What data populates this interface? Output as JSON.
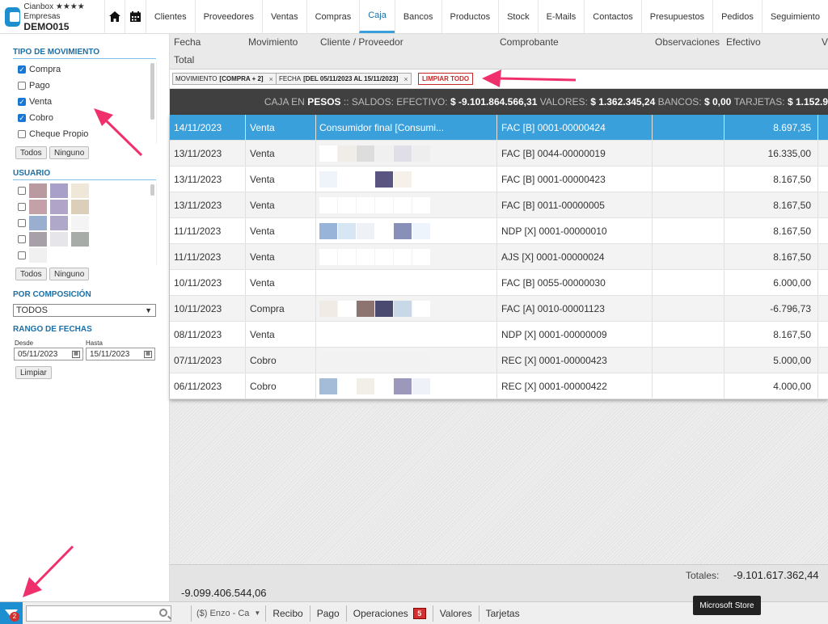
{
  "app": {
    "brand_line1": "Cianbox ★★★★ Empresas",
    "brand_line2": "DEMO015"
  },
  "nav": [
    "Clientes",
    "Proveedores",
    "Ventas",
    "Compras",
    "Caja",
    "Bancos",
    "Productos",
    "Stock",
    "E-Mails",
    "Contactos",
    "Presupuestos",
    "Pedidos",
    "Seguimiento"
  ],
  "nav_active": "Caja",
  "sidebar": {
    "tipo_title": "TIPO DE MOVIMIENTO",
    "tipo_items": [
      {
        "label": "Compra",
        "checked": true
      },
      {
        "label": "Pago",
        "checked": false
      },
      {
        "label": "Venta",
        "checked": true
      },
      {
        "label": "Cobro",
        "checked": true
      },
      {
        "label": "Cheque Propio",
        "checked": false
      }
    ],
    "btn_todos": "Todos",
    "btn_ninguno": "Ninguno",
    "usuario_title": "USUARIO",
    "composicion_title": "POR COMPOSICIÓN",
    "composicion_value": "TODOS",
    "rango_title": "RANGO DE FECHAS",
    "desde_label": "Desde",
    "hasta_label": "Hasta",
    "desde_value": "05/11/2023",
    "hasta_value": "15/11/2023",
    "btn_limpiar": "Limpiar"
  },
  "columns": {
    "fecha": "Fecha",
    "movimiento": "Movimiento",
    "cliente": "Cliente / Proveedor",
    "comprobante": "Comprobante",
    "observaciones": "Observaciones",
    "efectivo": "Efectivo",
    "v": "V",
    "total": "Total"
  },
  "chips": {
    "mov_label": "MOVIMIENTO",
    "mov_value": "[COMPRA + 2]",
    "fecha_label": "FECHA",
    "fecha_value": "[DEL 05/11/2023 AL 15/11/2023]",
    "clear": "LIMPIAR TODO",
    "x": "×"
  },
  "saldos": {
    "prefix": "CAJA EN",
    "moneda": "PESOS",
    "label_efectivo": ":: SALDOS: EFECTIVO:",
    "efectivo": "$ -9.101.864.566,31",
    "label_valores": "VALORES:",
    "valores": "$ 1.362.345,24",
    "label_bancos": "BANCOS:",
    "bancos": "$ 0,00",
    "label_tarjetas": "TARJETAS:",
    "tarjetas": "$ 1.152.9"
  },
  "rows": [
    {
      "fecha": "14/11/2023",
      "mov": "Venta",
      "cliente": "Consumidor final [Consumi...",
      "comp": "FAC [B] 0001-00000424",
      "efectivo": "8.697,35"
    },
    {
      "fecha": "13/11/2023",
      "mov": "Venta",
      "cliente": "",
      "comp": "FAC [B] 0044-00000019",
      "efectivo": "16.335,00"
    },
    {
      "fecha": "13/11/2023",
      "mov": "Venta",
      "cliente": "",
      "comp": "FAC [B] 0001-00000423",
      "efectivo": "8.167,50"
    },
    {
      "fecha": "13/11/2023",
      "mov": "Venta",
      "cliente": "",
      "comp": "FAC [B] 0011-00000005",
      "efectivo": "8.167,50"
    },
    {
      "fecha": "11/11/2023",
      "mov": "Venta",
      "cliente": "",
      "comp": "NDP [X] 0001-00000010",
      "efectivo": "8.167,50"
    },
    {
      "fecha": "11/11/2023",
      "mov": "Venta",
      "cliente": "",
      "comp": "AJS [X] 0001-00000024",
      "efectivo": "8.167,50"
    },
    {
      "fecha": "10/11/2023",
      "mov": "Venta",
      "cliente": "",
      "comp": "FAC [B] 0055-00000030",
      "efectivo": "6.000,00"
    },
    {
      "fecha": "10/11/2023",
      "mov": "Compra",
      "cliente": "",
      "comp": "FAC [A] 0010-00001123",
      "efectivo": "-6.796,73"
    },
    {
      "fecha": "08/11/2023",
      "mov": "Venta",
      "cliente": "",
      "comp": "NDP [X] 0001-00000009",
      "efectivo": "8.167,50"
    },
    {
      "fecha": "07/11/2023",
      "mov": "Cobro",
      "cliente": "",
      "comp": "REC [X] 0001-00000423",
      "efectivo": "5.000,00"
    },
    {
      "fecha": "06/11/2023",
      "mov": "Cobro",
      "cliente": "",
      "comp": "REC [X] 0001-00000422",
      "efectivo": "4.000,00"
    }
  ],
  "totals": {
    "label": "Totales:",
    "value": "-9.101.617.362,44",
    "left": "-9.099.406.544,06"
  },
  "bottom": {
    "badge": "2",
    "user_select": "($) Enzo - Ca",
    "recibo": "Recibo",
    "pago": "Pago",
    "operaciones": "Operaciones",
    "operaciones_badge": "5",
    "valores": "Valores",
    "tarjetas": "Tarjetas",
    "tooltip": "Microsoft Store"
  },
  "colors": {
    "accent": "#3aa0dc",
    "brand": "#1d8fd1",
    "danger": "#d32f2f",
    "arrow": "#f0306c"
  }
}
